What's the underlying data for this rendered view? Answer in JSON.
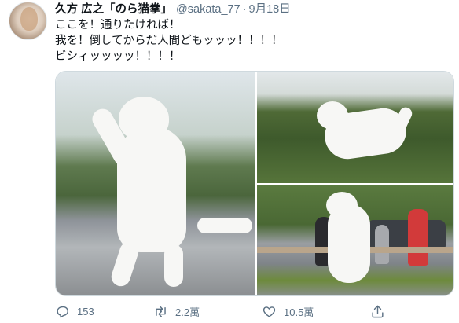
{
  "tweet": {
    "display_name": "久方 広之「のら猫拳」",
    "handle": "@sakata_77",
    "separator": "·",
    "date": "9月18日",
    "text_lines": [
      "ここを！通りたければ！",
      "我を！倒してからだ人間どもッッッ！！！！",
      "ビシィッッッッ！！！！"
    ],
    "media": {
      "photos": [
        {
          "alt": "standing white cat"
        },
        {
          "alt": "jumping white cat"
        },
        {
          "alt": "white cat with people"
        }
      ]
    },
    "actions": {
      "reply": {
        "icon": "reply-icon",
        "count": "153"
      },
      "retweet": {
        "icon": "retweet-icon",
        "count": "2.2萬"
      },
      "like": {
        "icon": "heart-icon",
        "count": "10.5萬"
      },
      "share": {
        "icon": "share-icon",
        "count": ""
      }
    },
    "colors": {
      "name": "#0f1419",
      "secondary": "#5b7083",
      "border": "#cfd9de"
    }
  }
}
